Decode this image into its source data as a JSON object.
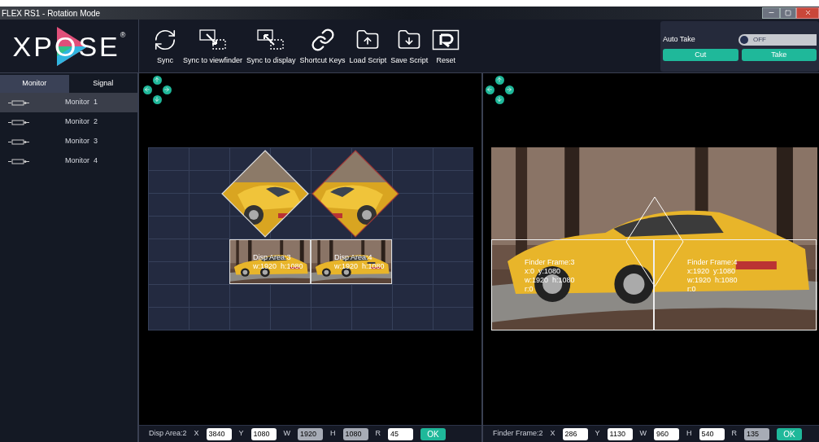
{
  "window": {
    "title": "FLEX RS1 - Rotation Mode"
  },
  "logo": {
    "text": "XPOSE",
    "mark": "®"
  },
  "toolbar": [
    {
      "kind": "sync",
      "label": "Sync"
    },
    {
      "kind": "to_viewfinder",
      "label": "Sync to viewfinder"
    },
    {
      "kind": "to_display",
      "label": "Sync to display"
    },
    {
      "kind": "link",
      "label": "Shortcut Keys"
    },
    {
      "kind": "load",
      "label": "Load Script"
    },
    {
      "kind": "save",
      "label": "Save Script"
    },
    {
      "kind": "reset",
      "label": "Reset"
    }
  ],
  "auto_take": {
    "label": "Auto Take",
    "on": false,
    "state_text": "OFF",
    "buttons": [
      "Cut",
      "Take"
    ]
  },
  "sidebar": {
    "tabs": [
      {
        "label": "Monitor",
        "selected": true
      },
      {
        "label": "Signal",
        "selected": false
      }
    ],
    "items": [
      {
        "label": "Monitor  1",
        "selected": true
      },
      {
        "label": "Monitor  2",
        "selected": false
      },
      {
        "label": "Monitor  3",
        "selected": false
      },
      {
        "label": "Monitor  4",
        "selected": false
      }
    ]
  },
  "display_panel": {
    "areas": [
      {
        "kind": "diamond_left",
        "selected": false
      },
      {
        "kind": "diamond_right",
        "selected": true
      },
      {
        "kind": "rect",
        "name": "Disp Area:3",
        "size": "w:1920  h:1080"
      },
      {
        "kind": "rect",
        "name": "Disp Area:4",
        "size": "w:1920  h:1080"
      }
    ],
    "footer": {
      "title": "Disp Area:2",
      "fields": [
        {
          "label": "X",
          "value": "3840",
          "disabled": false
        },
        {
          "label": "Y",
          "value": "1080",
          "disabled": false
        },
        {
          "label": "W",
          "value": "1920",
          "disabled": true
        },
        {
          "label": "H",
          "value": "1080",
          "disabled": true
        },
        {
          "label": "R",
          "value": "45",
          "disabled": false
        }
      ],
      "button": "OK"
    }
  },
  "finder_panel": {
    "frames": [
      {
        "name": "Finder Frame:3",
        "pos": "x:0  y:1080",
        "size": "w:1920  h:1080",
        "rot": "r:0"
      },
      {
        "name": "Finder Frame:4",
        "pos": "x:1920  y:1080",
        "size": "w:1920  h:1080",
        "rot": "r:0"
      }
    ],
    "footer": {
      "title": "Finder Frame:2",
      "fields": [
        {
          "label": "X",
          "value": "286",
          "disabled": false
        },
        {
          "label": "Y",
          "value": "1130",
          "disabled": false
        },
        {
          "label": "W",
          "value": "960",
          "disabled": false
        },
        {
          "label": "H",
          "value": "540",
          "disabled": false
        },
        {
          "label": "R",
          "value": "135",
          "disabled": true
        }
      ],
      "button": "OK"
    }
  }
}
